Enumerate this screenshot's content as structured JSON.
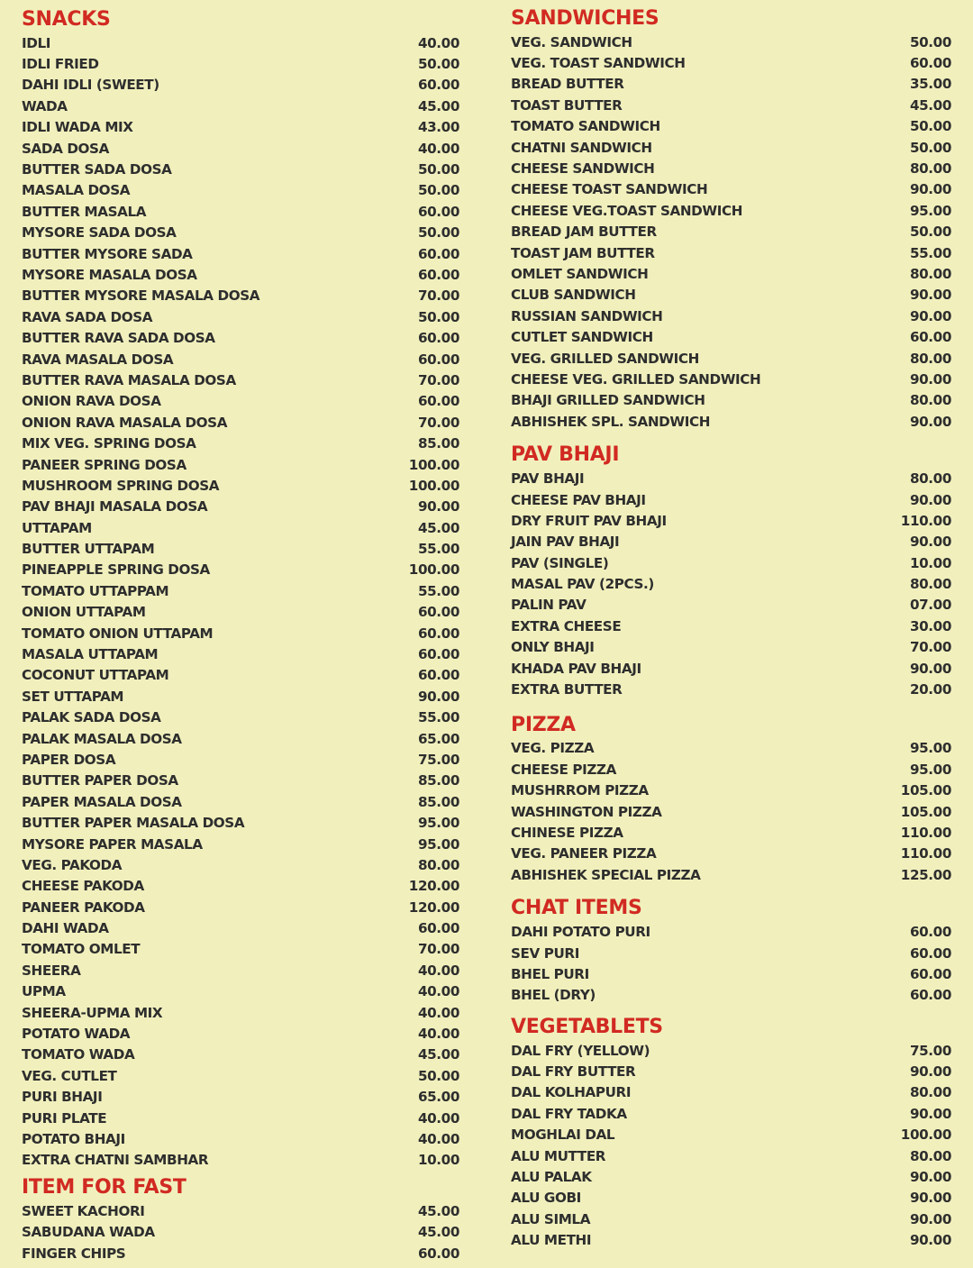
{
  "left_column": [
    {
      "title": "SNACKS",
      "items": [
        {
          "name": "IDLI",
          "price": "40.00"
        },
        {
          "name": "IDLI FRIED",
          "price": "50.00"
        },
        {
          "name": "DAHI IDLI (SWEET)",
          "price": "60.00"
        },
        {
          "name": "WADA",
          "price": "45.00"
        },
        {
          "name": "IDLI WADA MIX",
          "price": "43.00"
        },
        {
          "name": "SADA DOSA",
          "price": "40.00"
        },
        {
          "name": "BUTTER SADA DOSA",
          "price": "50.00"
        },
        {
          "name": "MASALA  DOSA",
          "price": "50.00"
        },
        {
          "name": "BUTTER MASALA",
          "price": "60.00"
        },
        {
          "name": "MYSORE SADA DOSA",
          "price": "50.00"
        },
        {
          "name": "BUTTER MYSORE SADA",
          "price": "60.00"
        },
        {
          "name": "MYSORE MASALA DOSA",
          "price": "60.00"
        },
        {
          "name": "BUTTER MYSORE MASALA DOSA",
          "price": "70.00"
        },
        {
          "name": "RAVA SADA DOSA",
          "price": "50.00"
        },
        {
          "name": "BUTTER RAVA SADA DOSA",
          "price": "60.00"
        },
        {
          "name": "RAVA MASALA DOSA",
          "price": "60.00"
        },
        {
          "name": "BUTTER RAVA MASALA DOSA",
          "price": "70.00"
        },
        {
          "name": "ONION RAVA DOSA",
          "price": "60.00"
        },
        {
          "name": "ONION RAVA MASALA DOSA",
          "price": "70.00"
        },
        {
          "name": "MIX VEG. SPRING DOSA",
          "price": "85.00"
        },
        {
          "name": "PANEER SPRING DOSA",
          "price": "100.00"
        },
        {
          "name": "MUSHROOM SPRING DOSA",
          "price": "100.00"
        },
        {
          "name": "PAV BHAJI MASALA DOSA",
          "price": "90.00"
        },
        {
          "name": "UTTAPAM",
          "price": "45.00"
        },
        {
          "name": "BUTTER UTTAPAM",
          "price": "55.00"
        },
        {
          "name": "PINEAPPLE SPRING DOSA",
          "price": "100.00"
        },
        {
          "name": "TOMATO UTTAPPAM",
          "price": "55.00"
        },
        {
          "name": "ONION UTTAPAM",
          "price": "60.00"
        },
        {
          "name": "TOMATO ONION UTTAPAM",
          "price": "60.00"
        },
        {
          "name": "MASALA UTTAPAM",
          "price": "60.00"
        },
        {
          "name": "COCONUT UTTAPAM",
          "price": "60.00"
        },
        {
          "name": "SET UTTAPAM",
          "price": "90.00"
        },
        {
          "name": "PALAK SADA DOSA",
          "price": "55.00"
        },
        {
          "name": "PALAK MASALA DOSA",
          "price": "65.00"
        },
        {
          "name": "PAPER DOSA",
          "price": "75.00"
        },
        {
          "name": "BUTTER PAPER DOSA",
          "price": "85.00"
        },
        {
          "name": " PAPER MASALA DOSA",
          "price": "85.00"
        },
        {
          "name": "BUTTER PAPER MASALA DOSA",
          "price": "95.00"
        },
        {
          "name": "MYSORE PAPER MASALA",
          "price": "95.00"
        },
        {
          "name": "VEG. PAKODA",
          "price": "80.00"
        },
        {
          "name": "CHEESE PAKODA",
          "price": "120.00"
        },
        {
          "name": "PANEER PAKODA",
          "price": "120.00"
        },
        {
          "name": "DAHI WADA",
          "price": "60.00"
        },
        {
          "name": "TOMATO OMLET",
          "price": "70.00"
        },
        {
          "name": "SHEERA",
          "price": "40.00"
        },
        {
          "name": "UPMA",
          "price": "40.00"
        },
        {
          "name": "SHEERA-UPMA MIX",
          "price": "40.00"
        },
        {
          "name": "POTATO WADA",
          "price": "40.00"
        },
        {
          "name": "TOMATO WADA",
          "price": "45.00"
        },
        {
          "name": "VEG. CUTLET",
          "price": "50.00"
        },
        {
          "name": "PURI BHAJI",
          "price": "65.00"
        },
        {
          "name": "PURI PLATE",
          "price": "40.00"
        },
        {
          "name": "POTATO BHAJI",
          "price": "40.00"
        },
        {
          "name": "EXTRA CHATNI SAMBHAR",
          "price": "10.00"
        }
      ]
    },
    {
      "title": "ITEM FOR FAST",
      "items": [
        {
          "name": "SWEET KACHORI",
          "price": "45.00"
        },
        {
          "name": "SABUDANA WADA",
          "price": "45.00"
        },
        {
          "name": "FINGER CHIPS",
          "price": "60.00"
        }
      ]
    }
  ],
  "right_column": [
    {
      "title": "SANDWICHES",
      "items": [
        {
          "name": "VEG. SANDWICH",
          "price": "50.00"
        },
        {
          "name": "VEG. TOAST SANDWICH",
          "price": "60.00"
        },
        {
          "name": "BREAD BUTTER",
          "price": "35.00"
        },
        {
          "name": "TOAST BUTTER",
          "price": "45.00"
        },
        {
          "name": "TOMATO SANDWICH",
          "price": "50.00"
        },
        {
          "name": "CHATNI SANDWICH",
          "price": "50.00"
        },
        {
          "name": "CHEESE SANDWICH",
          "price": "80.00"
        },
        {
          "name": "CHEESE TOAST SANDWICH",
          "price": "90.00"
        },
        {
          "name": "CHEESE VEG.TOAST SANDWICH",
          "price": "95.00"
        },
        {
          "name": "BREAD JAM BUTTER",
          "price": "50.00"
        },
        {
          "name": "TOAST JAM BUTTER",
          "price": "55.00"
        },
        {
          "name": "OMLET SANDWICH",
          "price": "80.00"
        },
        {
          "name": "CLUB SANDWICH",
          "price": "90.00"
        },
        {
          "name": "RUSSIAN SANDWICH",
          "price": "90.00"
        },
        {
          "name": "CUTLET SANDWICH",
          "price": "60.00"
        },
        {
          "name": "VEG. GRILLED SANDWICH",
          "price": "80.00"
        },
        {
          "name": "CHEESE  VEG. GRILLED SANDWICH",
          "price": "90.00"
        },
        {
          "name": "BHAJI  GRILLED SANDWICH",
          "price": "80.00"
        },
        {
          "name": "ABHISHEK SPL. SANDWICH",
          "price": "90.00"
        }
      ]
    },
    {
      "title": "PAV BHAJI",
      "items": [
        {
          "name": "PAV BHAJI",
          "price": "80.00"
        },
        {
          "name": "CHEESE  PAV BHAJI",
          "price": "90.00"
        },
        {
          "name": "DRY FRUIT PAV BHAJI",
          "price": "110.00"
        },
        {
          "name": "JAIN PAV BHAJI",
          "price": "90.00"
        },
        {
          "name": "PAV (SINGLE)",
          "price": "10.00"
        },
        {
          "name": "MASAL PAV (2PCS.)",
          "price": "80.00"
        },
        {
          "name": "PALIN PAV",
          "price": "07.00"
        },
        {
          "name": "EXTRA CHEESE",
          "price": "30.00"
        },
        {
          "name": "ONLY BHAJI",
          "price": "70.00"
        },
        {
          "name": "KHADA PAV BHAJI",
          "price": "90.00"
        },
        {
          "name": "EXTRA BUTTER",
          "price": "20.00"
        }
      ]
    },
    {
      "title": "PIZZA",
      "items": [
        {
          "name": "VEG. PIZZA",
          "price": "95.00"
        },
        {
          "name": "CHEESE PIZZA",
          "price": "95.00"
        },
        {
          "name": "MUSHRROM PIZZA",
          "price": "105.00"
        },
        {
          "name": "WASHINGTON PIZZA",
          "price": "105.00"
        },
        {
          "name": "CHINESE PIZZA",
          "price": "110.00"
        },
        {
          "name": "VEG. PANEER PIZZA",
          "price": "110.00"
        },
        {
          "name": "ABHISHEK SPECIAL PIZZA",
          "price": "125.00"
        }
      ]
    },
    {
      "title": "CHAT ITEMS",
      "items": [
        {
          "name": "DAHI POTATO PURI",
          "price": "60.00"
        },
        {
          "name": "SEV PURI",
          "price": "60.00"
        },
        {
          "name": "BHEL PURI",
          "price": "60.00"
        },
        {
          "name": "BHEL (DRY)",
          "price": "60.00"
        }
      ]
    },
    {
      "title": "VEGETABLETS",
      "items": [
        {
          "name": "DAL FRY (YELLOW)",
          "price": "75.00"
        },
        {
          "name": "DAL FRY BUTTER",
          "price": "90.00"
        },
        {
          "name": "DAL KOLHAPURI",
          "price": "80.00"
        },
        {
          "name": "DAL FRY TADKA",
          "price": "90.00"
        },
        {
          "name": "MOGHLAI DAL",
          "price": "100.00"
        },
        {
          "name": "ALU MUTTER",
          "price": "80.00"
        },
        {
          "name": "ALU PALAK",
          "price": "90.00"
        },
        {
          "name": "ALU GOBI",
          "price": "90.00"
        },
        {
          "name": "ALU SIMLA",
          "price": "90.00"
        },
        {
          "name": "ALU METHI",
          "price": "90.00"
        }
      ]
    }
  ],
  "colors": {
    "background": "#f1f0bd",
    "heading": "#d12a22",
    "text": "#2e2e2e"
  }
}
